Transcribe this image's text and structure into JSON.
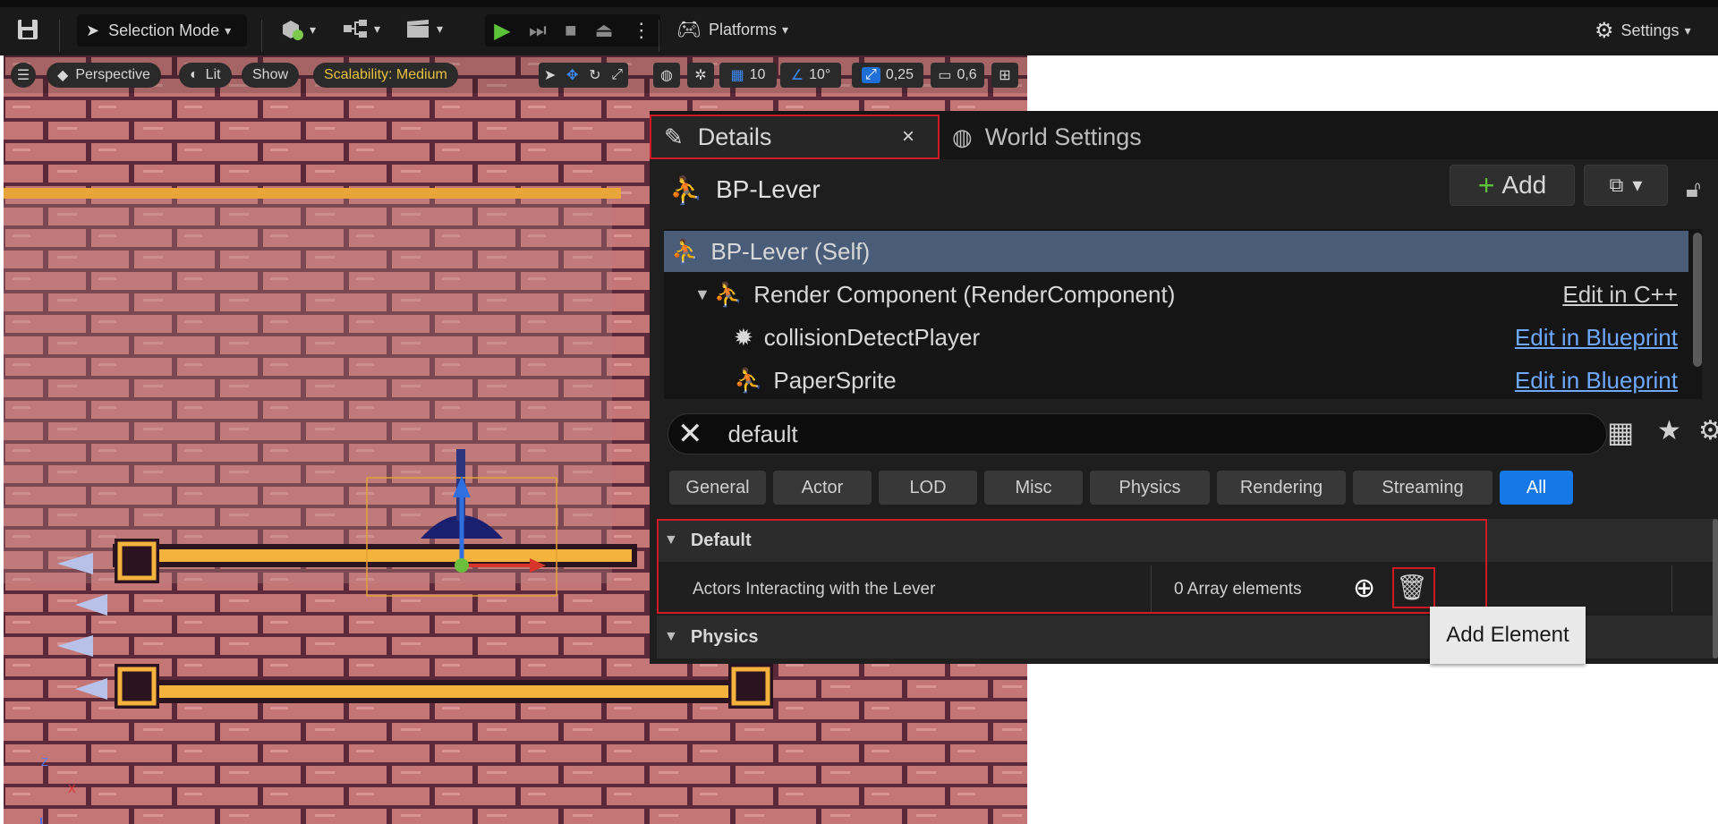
{
  "toolbar": {
    "selection_mode": "Selection Mode",
    "platforms": "Platforms",
    "settings": "Settings"
  },
  "viewport": {
    "perspective": "Perspective",
    "lit": "Lit",
    "show": "Show",
    "scalability": "Scalability: Medium",
    "grid_snap": "10",
    "angle_snap": "10°",
    "scale_snap": "0,25",
    "camera_speed": "0,6",
    "axis_z": "Z",
    "axis_x": "X",
    "axis_y": "Y"
  },
  "details": {
    "tab_details": "Details",
    "tab_world_settings": "World Settings",
    "actor_name": "BP-Lever",
    "add_label": "Add",
    "components": [
      {
        "label": "BP-Lever (Self)",
        "link": ""
      },
      {
        "label": "Render Component (RenderComponent)",
        "link": "Edit in C++"
      },
      {
        "label": "collisionDetectPlayer",
        "link": "Edit in Blueprint"
      },
      {
        "label": "PaperSprite",
        "link": "Edit in Blueprint"
      }
    ],
    "search_value": "default",
    "filters": [
      "General",
      "Actor",
      "LOD",
      "Misc",
      "Physics",
      "Rendering",
      "Streaming",
      "All"
    ],
    "section_default": "Default",
    "property_label": "Actors Interacting with the Lever",
    "property_value": "0 Array elements",
    "section_physics": "Physics",
    "tooltip": "Add Element"
  },
  "colors": {
    "highlight": "#d01a23",
    "accent_blue": "#1677e6",
    "link_blue": "#6ea8ff",
    "selected_row": "#4a5d78"
  }
}
